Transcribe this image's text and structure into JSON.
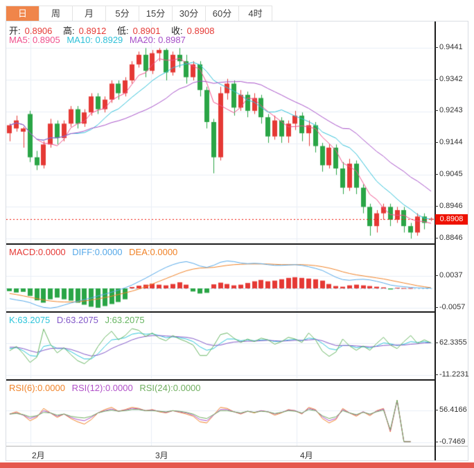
{
  "toolbar": {
    "tabs": [
      {
        "label": "日",
        "active": true
      },
      {
        "label": "周",
        "active": false
      },
      {
        "label": "月",
        "active": false
      },
      {
        "label": "5分",
        "active": false
      },
      {
        "label": "15分",
        "active": false
      },
      {
        "label": "30分",
        "active": false
      },
      {
        "label": "60分",
        "active": false
      },
      {
        "label": "4时",
        "active": false
      }
    ]
  },
  "main_chart": {
    "ohlc": {
      "open_label": "开:",
      "open": "0.8906",
      "high_label": "高:",
      "high": "0.8912",
      "low_label": "低:",
      "low": "0.8901",
      "close_label": "收:",
      "close": "0.8908"
    },
    "ma": {
      "ma5": "MA5: 0.8905",
      "ma10": "MA10: 0.8929",
      "ma20": "MA20: 0.8987"
    },
    "y_ticks": [
      "0.9441",
      "0.9342",
      "0.9243",
      "0.9144",
      "0.9045",
      "0.8946",
      "0.8846"
    ],
    "price_badge": "0.8908"
  },
  "macd_panel": {
    "labels": {
      "macd": "MACD:0.0000",
      "diff": "DIFF:0.0000",
      "dea": "DEA:0.0000"
    },
    "y_ticks": [
      "0.0037",
      "-0.0057"
    ]
  },
  "kdj_panel": {
    "labels": {
      "k": "K:63.2075",
      "d": "D:63.2075",
      "j": "J:63.2075"
    },
    "y_ticks": [
      "62.3355",
      "-11.2231"
    ]
  },
  "rsi_panel": {
    "labels": {
      "rsi6": "RSI(6):0.0000",
      "rsi12": "RSI(12):0.0000",
      "rsi24": "RSI(24):0.0000"
    },
    "y_ticks": [
      "56.4166",
      "-0.7469"
    ]
  },
  "x_axis": {
    "labels": [
      "2月",
      "3月",
      "4月"
    ]
  },
  "colors": {
    "up": "#e53935",
    "down": "#2aa546",
    "ma5": "#f0508c",
    "ma10": "#2ec0d8",
    "ma20": "#a64fc8",
    "diff": "#55a8e8",
    "dea": "#f08227",
    "k": "#2bc4da",
    "d": "#8157c8",
    "j": "#67b561",
    "rsi6": "#f08227",
    "rsi12": "#b050c8",
    "rsi24": "#6fae5f",
    "grid": "#e9eef6",
    "price_line": "#ee1100",
    "tab_accent": "#f0854a",
    "badge_bg": "#ee1100",
    "bottom_bar": "#e5584e"
  },
  "chart_data": [
    {
      "type": "candlestick",
      "title": "Daily candles with MA5/MA10/MA20",
      "yticks": [
        0.9441,
        0.9342,
        0.9243,
        0.9144,
        0.9045,
        0.8946,
        0.8846
      ],
      "ylim": [
        0.8829,
        0.9524
      ],
      "last_close": 0.8908,
      "ma_periods": [
        5,
        10,
        20
      ],
      "month_marks": [
        {
          "label": "2月",
          "i": 3.6
        },
        {
          "label": "3月",
          "i": 21.3
        },
        {
          "label": "4月",
          "i": 42.7
        }
      ],
      "ohlc": [
        [
          0.9175,
          0.9205,
          0.915,
          0.92
        ],
        [
          0.919,
          0.923,
          0.918,
          0.9215
        ],
        [
          0.918,
          0.9195,
          0.913,
          0.919
        ],
        [
          0.9235,
          0.9245,
          0.9085,
          0.91
        ],
        [
          0.91,
          0.912,
          0.906,
          0.9075
        ],
        [
          0.9075,
          0.915,
          0.9065,
          0.914
        ],
        [
          0.914,
          0.922,
          0.913,
          0.9205
        ],
        [
          0.9205,
          0.9215,
          0.914,
          0.916
        ],
        [
          0.916,
          0.9215,
          0.915,
          0.9205
        ],
        [
          0.9205,
          0.926,
          0.9195,
          0.925
        ],
        [
          0.925,
          0.926,
          0.919,
          0.9205
        ],
        [
          0.9205,
          0.925,
          0.9195,
          0.924
        ],
        [
          0.924,
          0.93,
          0.923,
          0.929
        ],
        [
          0.929,
          0.93,
          0.9235,
          0.925
        ],
        [
          0.925,
          0.929,
          0.924,
          0.928
        ],
        [
          0.928,
          0.934,
          0.927,
          0.933
        ],
        [
          0.933,
          0.934,
          0.928,
          0.93
        ],
        [
          0.93,
          0.935,
          0.929,
          0.934
        ],
        [
          0.934,
          0.94,
          0.933,
          0.939
        ],
        [
          0.939,
          0.943,
          0.938,
          0.942
        ],
        [
          0.942,
          0.9441,
          0.935,
          0.937
        ],
        [
          0.937,
          0.9435,
          0.936,
          0.9425
        ],
        [
          0.9425,
          0.9441,
          0.94,
          0.9435
        ],
        [
          0.9435,
          0.944,
          0.934,
          0.9365
        ],
        [
          0.9365,
          0.943,
          0.9355,
          0.942
        ],
        [
          0.942,
          0.9441,
          0.938,
          0.94
        ],
        [
          0.94,
          0.942,
          0.933,
          0.935
        ],
        [
          0.935,
          0.94,
          0.934,
          0.939
        ],
        [
          0.939,
          0.94,
          0.929,
          0.931
        ],
        [
          0.931,
          0.932,
          0.919,
          0.921
        ],
        [
          0.921,
          0.922,
          0.905,
          0.91
        ],
        [
          0.91,
          0.932,
          0.909,
          0.93
        ],
        [
          0.93,
          0.9345,
          0.928,
          0.933
        ],
        [
          0.933,
          0.934,
          0.923,
          0.9255
        ],
        [
          0.9255,
          0.931,
          0.9245,
          0.9295
        ],
        [
          0.9295,
          0.9305,
          0.9225,
          0.9245
        ],
        [
          0.9245,
          0.93,
          0.9235,
          0.9285
        ],
        [
          0.9285,
          0.9295,
          0.9205,
          0.9225
        ],
        [
          0.9225,
          0.9235,
          0.9145,
          0.9165
        ],
        [
          0.9165,
          0.923,
          0.9155,
          0.9215
        ],
        [
          0.9215,
          0.9225,
          0.9145,
          0.9165
        ],
        [
          0.9165,
          0.9215,
          0.9145,
          0.9205
        ],
        [
          0.9205,
          0.9245,
          0.9185,
          0.923
        ],
        [
          0.923,
          0.924,
          0.915,
          0.9175
        ],
        [
          0.9175,
          0.9215,
          0.9135,
          0.92
        ],
        [
          0.92,
          0.921,
          0.9115,
          0.9135
        ],
        [
          0.9135,
          0.9145,
          0.9055,
          0.9075
        ],
        [
          0.9075,
          0.914,
          0.9065,
          0.913
        ],
        [
          0.913,
          0.914,
          0.9045,
          0.9065
        ],
        [
          0.9065,
          0.9085,
          0.8985,
          0.9005
        ],
        [
          0.9005,
          0.9095,
          0.8995,
          0.908
        ],
        [
          0.908,
          0.909,
          0.8985,
          0.9005
        ],
        [
          0.9005,
          0.9015,
          0.8925,
          0.8945
        ],
        [
          0.8945,
          0.8955,
          0.8855,
          0.8885
        ],
        [
          0.8885,
          0.8935,
          0.8865,
          0.8925
        ],
        [
          0.8925,
          0.8955,
          0.8905,
          0.8945
        ],
        [
          0.8945,
          0.8955,
          0.8885,
          0.8905
        ],
        [
          0.8905,
          0.8945,
          0.8895,
          0.8935
        ],
        [
          0.8935,
          0.8945,
          0.8865,
          0.8885
        ],
        [
          0.8885,
          0.8895,
          0.8846,
          0.8865
        ],
        [
          0.8865,
          0.8925,
          0.8855,
          0.8915
        ],
        [
          0.8915,
          0.8925,
          0.8875,
          0.8895
        ],
        [
          0.8906,
          0.8912,
          0.8901,
          0.8908
        ]
      ]
    },
    {
      "type": "bar",
      "name": "MACD",
      "yticks": [
        0.0037,
        -0.0057
      ],
      "ylim": [
        -0.00695,
        0.01308
      ],
      "bars": [
        -0.0008,
        -0.0012,
        -0.001,
        -0.0022,
        -0.0035,
        -0.0042,
        -0.0032,
        -0.0027,
        -0.0032,
        -0.0036,
        -0.0042,
        -0.0048,
        -0.0054,
        -0.0057,
        -0.0052,
        -0.0046,
        -0.004,
        -0.0032,
        0.0004,
        0.0008,
        0.0011,
        0.0014,
        0.0011,
        0.0009,
        0.0013,
        0.0018,
        0.0011,
        -0.0009,
        -0.0015,
        -0.0013,
        0.0012,
        0.0017,
        0.0013,
        0.0009,
        0.0011,
        0.0016,
        0.0021,
        0.0025,
        0.0021,
        0.0023,
        0.0027,
        0.0031,
        0.0033,
        0.0031,
        0.0029,
        0.0027,
        0.0023,
        0.0013,
        0.0007,
        0.0005,
        0.0009,
        0.0011,
        0.0009,
        0.0007,
        0.0005,
        0.0003,
        -0.0003,
        0.0002,
        0.0001,
        0.0001,
        0.0,
        0.0,
        0.0
      ],
      "diff": [
        -0.003,
        -0.0034,
        -0.0037,
        -0.0042,
        -0.005,
        -0.0056,
        -0.0058,
        -0.0055,
        -0.0049,
        -0.0043,
        -0.0038,
        -0.0033,
        -0.0028,
        -0.0022,
        -0.0017,
        -0.0011,
        -0.0005,
        0.0002,
        0.001,
        0.002,
        0.003,
        0.0041,
        0.0052,
        0.0062,
        0.007,
        0.0076,
        0.0079,
        0.0074,
        0.0066,
        0.0062,
        0.0068,
        0.0077,
        0.0081,
        0.0079,
        0.0075,
        0.0073,
        0.0074,
        0.0073,
        0.007,
        0.0068,
        0.0068,
        0.0069,
        0.007,
        0.0068,
        0.0064,
        0.0059,
        0.0053,
        0.0043,
        0.0033,
        0.0026,
        0.0024,
        0.0026,
        0.0027,
        0.0025,
        0.0021,
        0.0016,
        0.001,
        0.0007,
        0.0005,
        0.0003,
        0.0002,
        0.0001,
        0.0001
      ],
      "dea": [
        -0.0015,
        -0.0018,
        -0.0022,
        -0.0026,
        -0.003,
        -0.0034,
        -0.0037,
        -0.0039,
        -0.004,
        -0.004,
        -0.0039,
        -0.0037,
        -0.0034,
        -0.0031,
        -0.0027,
        -0.0023,
        -0.0018,
        -0.0013,
        -0.0008,
        -0.0002,
        0.0005,
        0.0013,
        0.0021,
        0.0029,
        0.0037,
        0.0045,
        0.0052,
        0.0057,
        0.006,
        0.0061,
        0.0062,
        0.0065,
        0.0068,
        0.007,
        0.0071,
        0.0072,
        0.0072,
        0.0072,
        0.0072,
        0.0071,
        0.007,
        0.007,
        0.007,
        0.007,
        0.0069,
        0.0067,
        0.0064,
        0.006,
        0.0055,
        0.0049,
        0.0044,
        0.004,
        0.0037,
        0.0034,
        0.0031,
        0.0028,
        0.0024,
        0.002,
        0.0016,
        0.0012,
        0.0008,
        0.0005,
        0.0002
      ]
    },
    {
      "type": "line",
      "name": "KDJ",
      "yticks": [
        62.3355,
        -11.2231
      ],
      "ylim": [
        -22.4,
        134.3
      ],
      "series": [
        {
          "name": "K",
          "values": [
            50,
            52,
            45,
            34,
            32,
            55,
            58,
            50,
            50,
            43,
            34,
            26,
            26,
            38,
            55,
            70,
            72,
            75,
            83,
            86,
            83,
            84,
            80,
            75,
            77,
            75,
            72,
            66,
            54,
            46,
            50,
            62,
            72,
            72,
            68,
            70,
            68,
            70,
            70,
            66,
            67,
            70,
            71,
            68,
            74,
            72,
            62,
            50,
            47,
            57,
            57,
            52,
            54,
            51,
            56,
            63,
            61,
            57,
            60,
            66,
            64,
            66,
            63.2
          ]
        },
        {
          "name": "D",
          "values": [
            53,
            53,
            50,
            45,
            41,
            46,
            50,
            51,
            51,
            48,
            43,
            37,
            33,
            35,
            41,
            50,
            57,
            63,
            70,
            75,
            78,
            80,
            80,
            79,
            78,
            77,
            76,
            73,
            67,
            60,
            57,
            58,
            62,
            65,
            66,
            67,
            67,
            68,
            69,
            68,
            67,
            68,
            69,
            69,
            70,
            71,
            68,
            62,
            57,
            57,
            57,
            56,
            55,
            54,
            55,
            57,
            58,
            58,
            58,
            60,
            61,
            63,
            63.2
          ]
        },
        {
          "name": "J",
          "values": [
            45,
            55,
            38,
            18,
            30,
            95,
            60,
            40,
            52,
            36,
            22,
            15,
            28,
            55,
            76,
            90,
            70,
            80,
            96,
            92,
            78,
            86,
            74,
            68,
            80,
            72,
            66,
            58,
            34,
            34,
            56,
            82,
            86,
            74,
            64,
            72,
            66,
            74,
            70,
            60,
            66,
            76,
            72,
            64,
            86,
            70,
            44,
            32,
            42,
            72,
            56,
            46,
            56,
            46,
            62,
            76,
            58,
            50,
            66,
            80,
            62,
            70,
            63.2
          ]
        }
      ]
    },
    {
      "type": "line",
      "name": "RSI",
      "yticks": [
        56.4166,
        -0.7469
      ],
      "ylim": [
        -6.96,
        111.1
      ],
      "series": [
        {
          "name": "RSI6",
          "values": [
            50,
            54,
            48,
            38,
            44,
            60,
            52,
            44,
            50,
            42,
            36,
            32,
            40,
            52,
            58,
            62,
            55,
            58,
            62,
            60,
            56,
            58,
            54,
            52,
            56,
            53,
            50,
            46,
            36,
            34,
            48,
            62,
            60,
            54,
            50,
            55,
            52,
            56,
            54,
            48,
            52,
            58,
            56,
            50,
            62,
            58,
            42,
            34,
            40,
            60,
            52,
            46,
            54,
            47,
            56,
            60,
            18,
            75,
            0.5,
            0.5,
            null,
            null,
            null
          ]
        },
        {
          "name": "RSI12",
          "values": [
            50,
            52,
            48,
            42,
            46,
            56,
            52,
            46,
            50,
            44,
            40,
            38,
            44,
            52,
            56,
            59,
            55,
            57,
            60,
            59,
            56,
            57,
            55,
            53,
            56,
            54,
            52,
            48,
            40,
            38,
            48,
            58,
            58,
            54,
            51,
            55,
            53,
            56,
            54,
            50,
            53,
            57,
            56,
            51,
            60,
            57,
            45,
            38,
            42,
            58,
            52,
            48,
            54,
            49,
            55,
            59,
            20,
            74,
            0.5,
            0.5,
            null,
            null,
            null
          ]
        },
        {
          "name": "RSI24",
          "values": [
            50,
            51,
            49,
            45,
            47,
            53,
            52,
            48,
            50,
            46,
            44,
            43,
            46,
            52,
            55,
            57,
            55,
            56,
            58,
            58,
            56,
            56,
            55,
            54,
            56,
            55,
            53,
            50,
            44,
            42,
            49,
            56,
            56,
            54,
            52,
            55,
            53,
            55,
            54,
            51,
            53,
            56,
            55,
            52,
            58,
            56,
            47,
            42,
            45,
            56,
            52,
            49,
            53,
            50,
            54,
            57,
            22,
            75,
            0.5,
            0.5,
            null,
            null,
            null
          ]
        }
      ]
    }
  ]
}
